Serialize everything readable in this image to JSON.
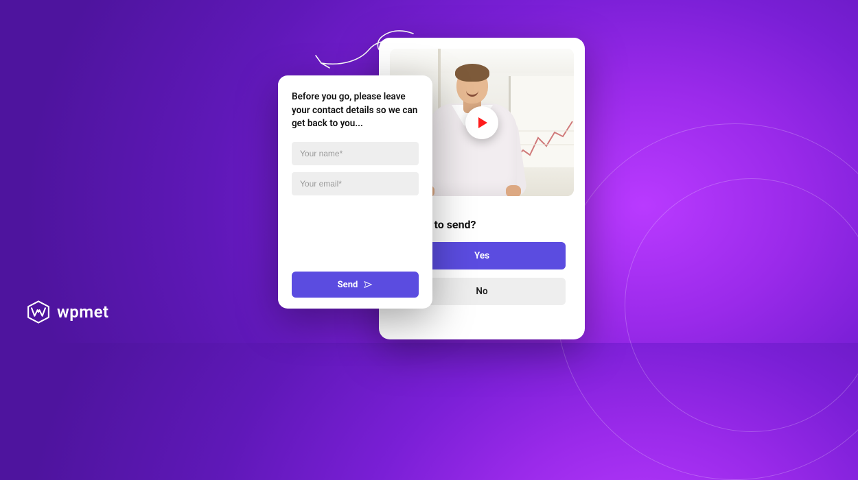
{
  "brand": {
    "name": "wpmet"
  },
  "colors": {
    "primary": "#5b4ce0",
    "danger": "#ff1b1b"
  },
  "contact_card": {
    "message": "Before you go, please leave your contact details so we can get back to you...",
    "name_placeholder": "Your name*",
    "email_placeholder": "Your email*",
    "name_value": "",
    "email_value": "",
    "send_label": "Send"
  },
  "confirm_card": {
    "title": "Ready to send?",
    "yes_label": "Yes",
    "no_label": "No"
  },
  "video": {
    "play_icon": "play-icon"
  }
}
